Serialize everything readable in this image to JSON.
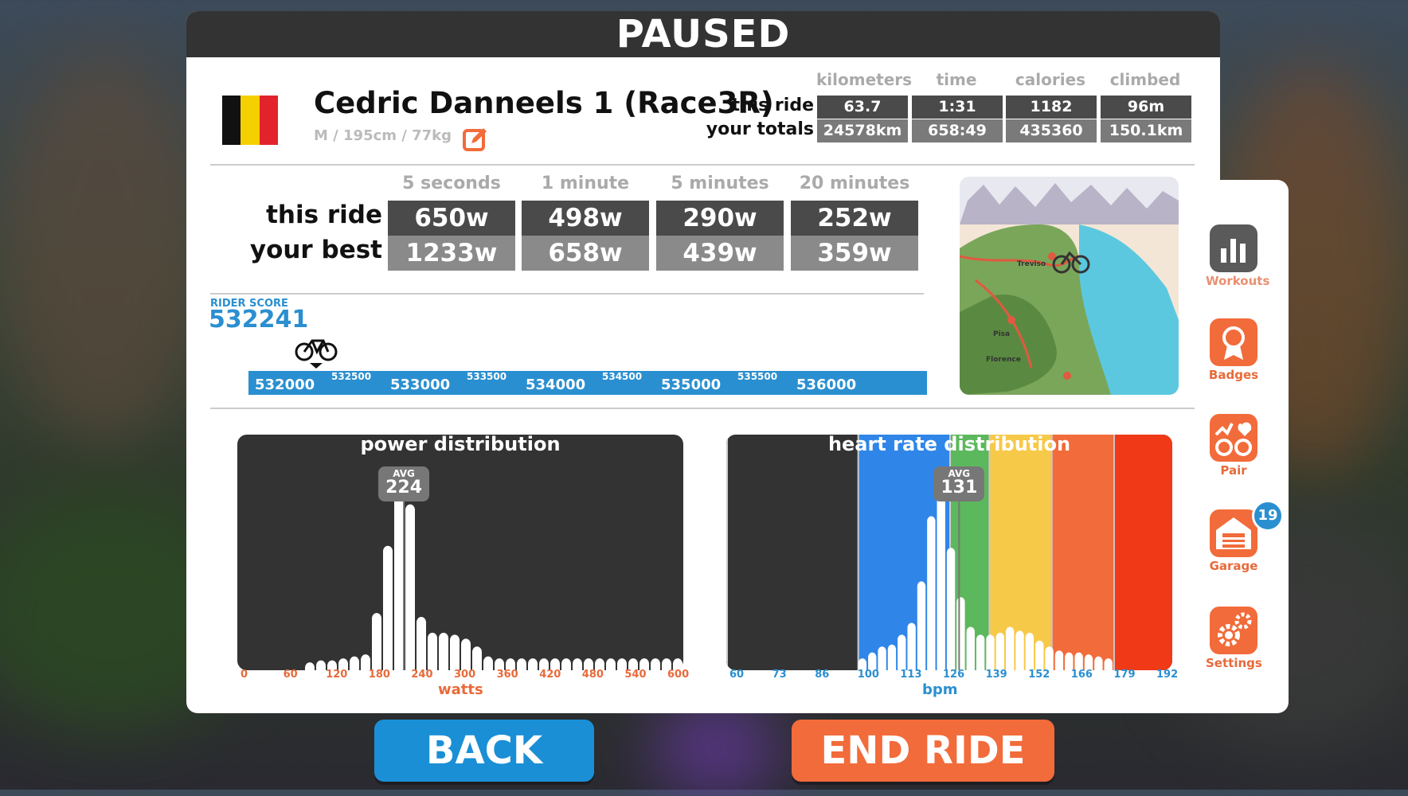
{
  "header": {
    "title": "PAUSED"
  },
  "rider": {
    "name": "Cedric Danneels 1 (Race3R)",
    "info": "M / 195cm / 77kg",
    "flag_colors": [
      "#111111",
      "#f5d000",
      "#e3232c"
    ]
  },
  "stats": {
    "headers": [
      "kilometers",
      "time",
      "calories",
      "climbed"
    ],
    "this_ride_label": "this ride",
    "totals_label": "your totals",
    "this_ride": [
      "63.7",
      "1:31",
      "1182",
      "96m"
    ],
    "totals": [
      "24578km",
      "658:49",
      "435360",
      "150.1km"
    ]
  },
  "power": {
    "headers": [
      "5 seconds",
      "1 minute",
      "5 minutes",
      "20 minutes"
    ],
    "this_ride_label": "this ride",
    "best_label": "your best",
    "this_ride": [
      "650w",
      "498w",
      "290w",
      "252w"
    ],
    "best": [
      "1233w",
      "658w",
      "439w",
      "359w"
    ]
  },
  "map": {
    "labels": [
      "Treviso",
      "Pisa",
      "Florence"
    ]
  },
  "rider_score": {
    "label": "RIDER SCORE",
    "value": "532241",
    "major_ticks": [
      "532000",
      "533000",
      "534000",
      "535000",
      "536000"
    ],
    "minor_ticks": [
      "532500",
      "533500",
      "534500",
      "535500"
    ]
  },
  "chart_data": [
    {
      "type": "bar",
      "title": "power distribution",
      "xlabel": "watts",
      "x_ticks": [
        "0",
        "60",
        "120",
        "180",
        "240",
        "300",
        "360",
        "420",
        "480",
        "540",
        "600"
      ],
      "avg_label": "AVG",
      "avg_value": "224",
      "avg": 224,
      "bin_width": 15,
      "x": [
        90,
        105,
        120,
        135,
        150,
        165,
        180,
        195,
        210,
        225,
        240,
        255,
        270,
        285,
        300,
        315,
        330,
        345,
        360,
        375,
        390,
        405,
        420,
        435,
        450,
        465,
        480,
        495,
        510,
        525,
        540,
        555,
        570,
        585
      ],
      "values": [
        0.04,
        0.05,
        0.05,
        0.06,
        0.07,
        0.08,
        0.29,
        0.63,
        1.0,
        0.84,
        0.27,
        0.19,
        0.19,
        0.18,
        0.16,
        0.12,
        0.07,
        0.06,
        0.06,
        0.06,
        0.06,
        0.06,
        0.06,
        0.06,
        0.06,
        0.06,
        0.06,
        0.06,
        0.06,
        0.06,
        0.06,
        0.06,
        0.06,
        0.06
      ]
    },
    {
      "type": "bar",
      "title": "heart rate distribution",
      "xlabel": "bpm",
      "x_ticks": [
        "60",
        "73",
        "86",
        "100",
        "113",
        "126",
        "139",
        "152",
        "166",
        "179",
        "192"
      ],
      "avg_label": "AVG",
      "avg_value": "131",
      "avg": 131,
      "zones": [
        {
          "from": 60,
          "to": 100,
          "color": "#333333"
        },
        {
          "from": 100,
          "to": 128,
          "color": "#2f86e8"
        },
        {
          "from": 128,
          "to": 140,
          "color": "#5cb85c"
        },
        {
          "from": 140,
          "to": 159,
          "color": "#f7c948"
        },
        {
          "from": 159,
          "to": 178,
          "color": "#f26b3a"
        },
        {
          "from": 178,
          "to": 196,
          "color": "#f03a17"
        }
      ],
      "bin_width": 3,
      "x": [
        100,
        103,
        106,
        109,
        112,
        115,
        118,
        121,
        124,
        127,
        130,
        133,
        136,
        139,
        142,
        145,
        148,
        151,
        154,
        157,
        160,
        163,
        166,
        169,
        172,
        175
      ],
      "values": [
        0.06,
        0.09,
        0.12,
        0.13,
        0.18,
        0.24,
        0.45,
        0.78,
        1.0,
        0.62,
        0.37,
        0.22,
        0.18,
        0.18,
        0.19,
        0.22,
        0.2,
        0.19,
        0.15,
        0.12,
        0.1,
        0.09,
        0.09,
        0.08,
        0.07,
        0.06
      ]
    }
  ],
  "sidebar": {
    "items": [
      {
        "label": "Workouts",
        "icon": "bar-chart-icon"
      },
      {
        "label": "Badges",
        "icon": "ribbon-icon"
      },
      {
        "label": "Pair",
        "icon": "pair-icon"
      },
      {
        "label": "Garage",
        "icon": "garage-icon"
      },
      {
        "label": "Settings",
        "icon": "gear-icon"
      }
    ],
    "garage_badge": "19"
  },
  "buttons": {
    "back": "BACK",
    "end_ride": "END RIDE"
  },
  "colors": {
    "accent_blue": "#1a8fd6",
    "accent_orange": "#f26b3a",
    "panel_dark": "#333333"
  }
}
